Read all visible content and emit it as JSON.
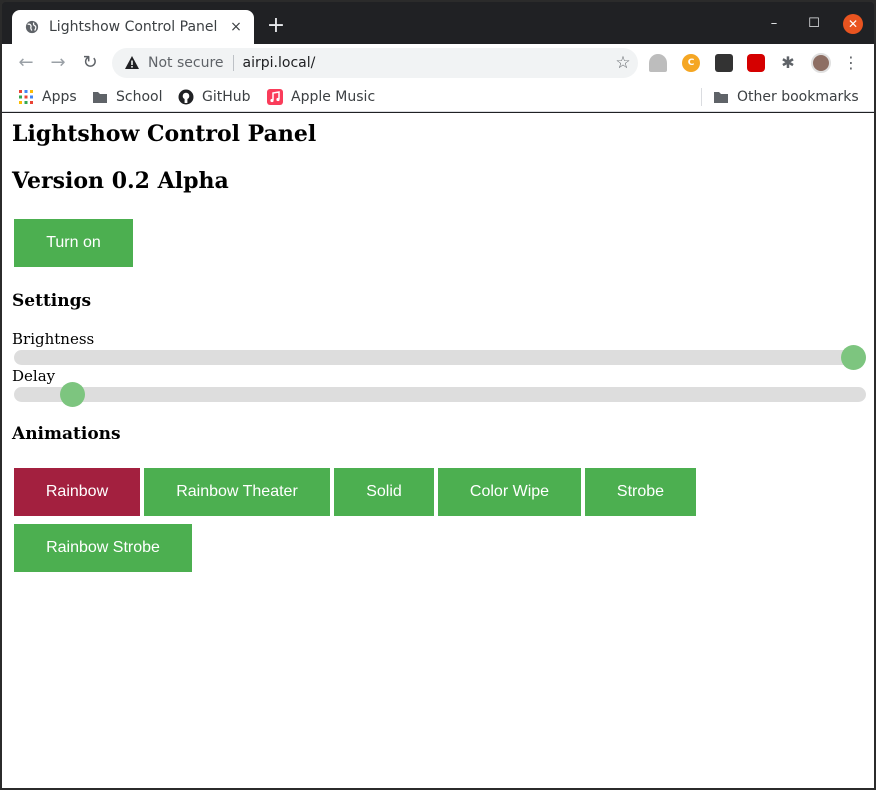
{
  "browser": {
    "tab_title": "Lightshow Control Panel",
    "tab_close": "×",
    "new_tab": "+",
    "window_min": "–",
    "window_max": "☐",
    "window_close": "✕",
    "security_label": "Not secure",
    "url": "airpi.local/",
    "bookmarks": {
      "apps": "Apps",
      "school": "School",
      "github": "GitHub",
      "apple_music": "Apple Music",
      "other": "Other bookmarks"
    }
  },
  "page": {
    "title": "Lightshow Control Panel",
    "version": "Version 0.2 Alpha",
    "power_button": "Turn on",
    "settings_heading": "Settings",
    "brightness_label": "Brightness",
    "brightness_value": 1.0,
    "delay_label": "Delay",
    "delay_value": 0.056,
    "animations_heading": "Animations",
    "animations": [
      {
        "label": "Rainbow",
        "active": true
      },
      {
        "label": "Rainbow Theater",
        "active": false
      },
      {
        "label": "Solid",
        "active": false
      },
      {
        "label": "Color Wipe",
        "active": false
      },
      {
        "label": "Strobe",
        "active": false
      },
      {
        "label": "Rainbow Strobe",
        "active": false
      }
    ]
  },
  "colors": {
    "button_green": "#4caf50",
    "button_active": "#a3203f",
    "slider_thumb": "#7dc57f",
    "slider_track": "#dddddd"
  }
}
